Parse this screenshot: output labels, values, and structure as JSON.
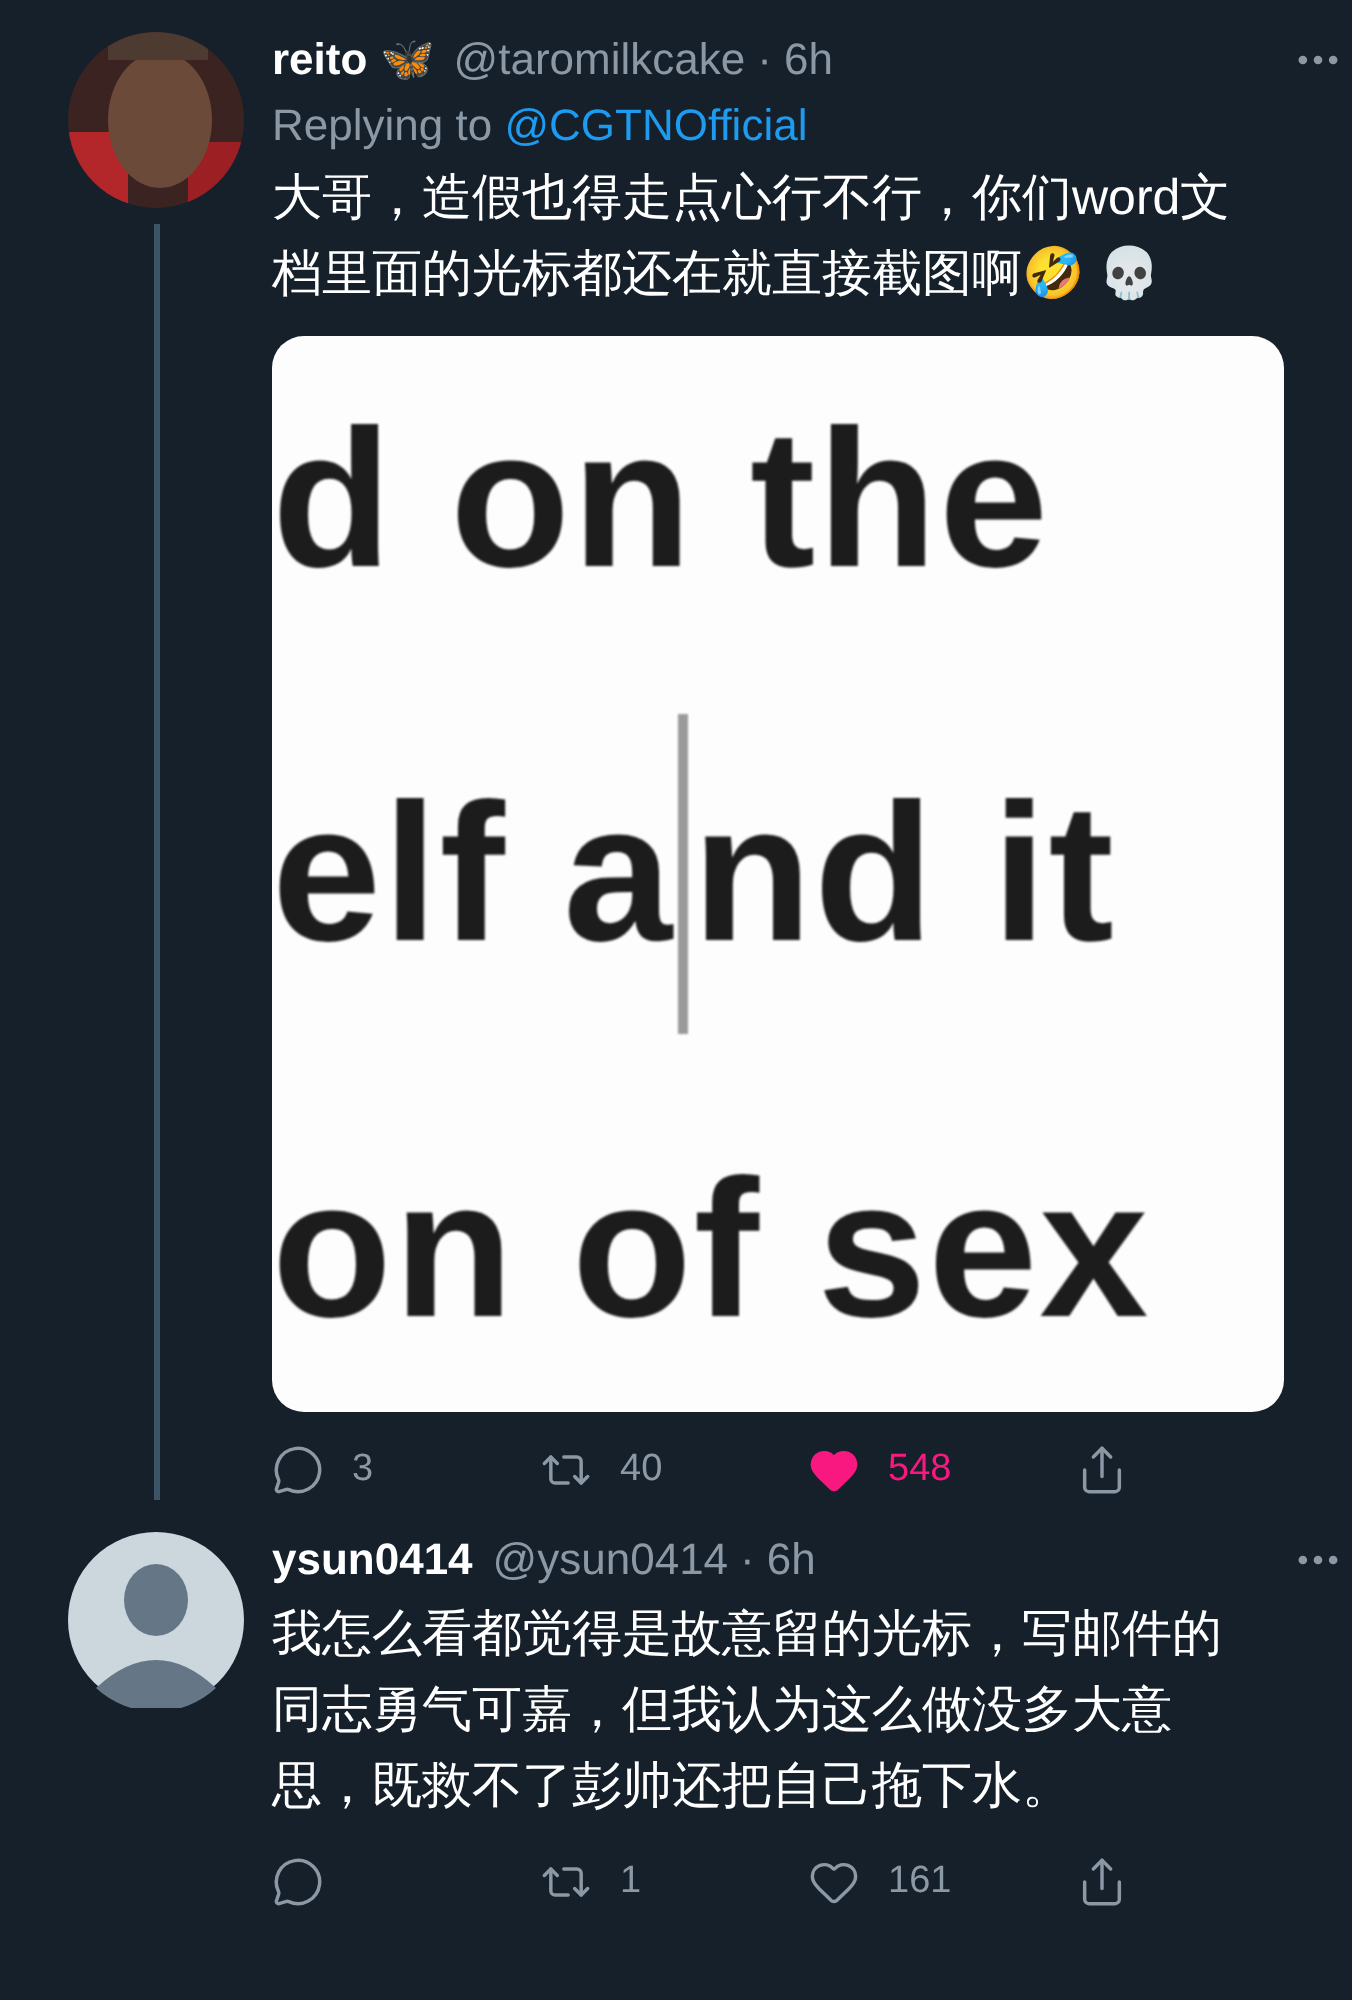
{
  "tweets": [
    {
      "name": "reito 🦋",
      "handle": "@taromilkcake",
      "dot": "·",
      "time": "6h",
      "replying_label": "Replying to",
      "replying_to": "@CGTNOfficial",
      "text": "大哥，造假也得走点心行不行，你们word文档里面的光标都还在就直接截图啊🤣 💀",
      "thread_line": true,
      "image": {
        "lines": [
          {
            "text": "d on the",
            "cursor": false
          },
          {
            "text": "elf a",
            "cursor": true,
            "text_after": "nd it"
          },
          {
            "text": "on of sex",
            "cursor": false
          }
        ]
      },
      "actions": [
        {
          "kind": "reply",
          "count": "3",
          "liked": false
        },
        {
          "kind": "retweet",
          "count": "40",
          "liked": false
        },
        {
          "kind": "like",
          "count": "548",
          "liked": true
        },
        {
          "kind": "share",
          "liked": false
        }
      ]
    },
    {
      "avatar": {
        "kind": "default"
      },
      "name": "ysun0414",
      "handle": "@ysun0414",
      "dot": "·",
      "time": "6h",
      "text": "我怎么看都觉得是故意留的光标，写邮件的同志勇气可嘉，但我认为这么做没多大意思，既救不了彭帅还把自己拖下水。",
      "thread_line": false,
      "actions": [
        {
          "kind": "reply",
          "liked": false
        },
        {
          "kind": "retweet",
          "count": "1",
          "liked": false
        },
        {
          "kind": "like",
          "count": "161",
          "liked": false
        },
        {
          "kind": "share",
          "liked": false
        }
      ]
    }
  ]
}
